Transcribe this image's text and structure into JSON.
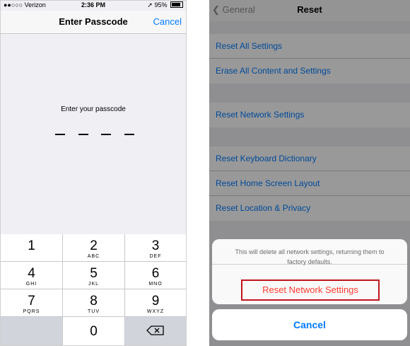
{
  "left_phone": {
    "status": {
      "carrier": "●●○○○ Verizon",
      "time": "2:36 PM",
      "battery": "95%"
    },
    "nav": {
      "title": "Enter Passcode",
      "cancel": "Cancel"
    },
    "prompt": "Enter your passcode",
    "keys": [
      {
        "num": "1",
        "letters": ""
      },
      {
        "num": "2",
        "letters": "ABC"
      },
      {
        "num": "3",
        "letters": "DEF"
      },
      {
        "num": "4",
        "letters": "GHI"
      },
      {
        "num": "5",
        "letters": "JKL"
      },
      {
        "num": "6",
        "letters": "MNO"
      },
      {
        "num": "7",
        "letters": "PQRS"
      },
      {
        "num": "8",
        "letters": "TUV"
      },
      {
        "num": "9",
        "letters": "WXYZ"
      },
      {
        "num": "0",
        "letters": ""
      }
    ],
    "delete_icon": "delete-backspace-icon"
  },
  "right_phone": {
    "nav": {
      "back": "General",
      "title": "Reset"
    },
    "groups": [
      [
        "Reset All Settings",
        "Erase All Content and Settings"
      ],
      [
        "Reset Network Settings"
      ],
      [
        "Reset Keyboard Dictionary",
        "Reset Home Screen Layout",
        "Reset Location & Privacy"
      ]
    ],
    "sheet": {
      "message": "This will delete all network settings, returning them to factory defaults.",
      "action": "Reset Network Settings",
      "cancel": "Cancel"
    },
    "colors": {
      "link": "#007aff",
      "destructive": "#ff3b30",
      "highlight_border": "#c0151e"
    }
  }
}
